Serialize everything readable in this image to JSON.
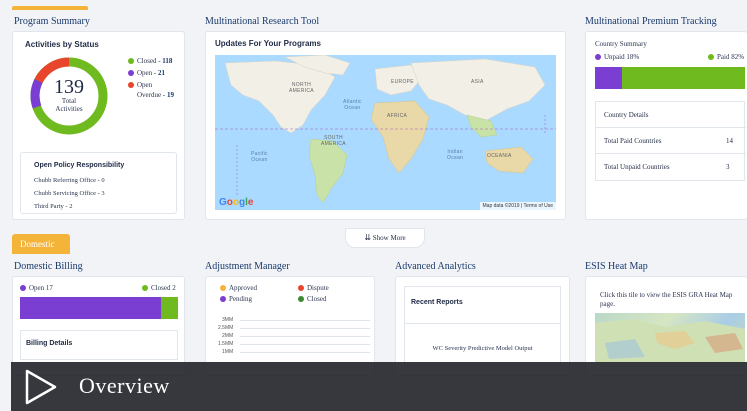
{
  "sections": {
    "program_summary": "Program Summary",
    "research_tool": "Multinational Research Tool",
    "premium_tracking": "Multinational Premium Tracking",
    "domestic_billing": "Domestic Billing",
    "adjustment_manager": "Adjustment Manager",
    "advanced_analytics": "Advanced Analytics",
    "heat_map": "ESIS Heat Map"
  },
  "program_summary": {
    "header": "Activities by Status",
    "total": "139",
    "total_label_1": "Total",
    "total_label_2": "Activities",
    "legend": [
      {
        "label": "Closed",
        "value": "118",
        "color": "#6fba1e"
      },
      {
        "label": "Open",
        "value": "21",
        "color": "#7b3ed2"
      },
      {
        "label_1": "Open",
        "label_2": "Overdue",
        "value": "19",
        "color": "#e8452c"
      }
    ],
    "policy": {
      "title": "Open Policy Responsibility",
      "lines": [
        "Chubb Referring Office - 0",
        "Chubb Servicing Office - 3",
        "Third Party - 2"
      ]
    }
  },
  "research_tool": {
    "header": "Updates For Your Programs",
    "map_labels": {
      "north_america": "NORTH\nAMERICA",
      "europe": "EUROPE",
      "asia": "ASIA",
      "africa": "AFRICA",
      "south_america": "SOUTH\nAMERICA",
      "oceania": "OCEANIA",
      "atlantic": "Atlantic\nOcean",
      "pacific": "Pacific\nOcean",
      "indian": "Indian\nOcean"
    },
    "map_footer": "Map data ©2019 | Terms of Use",
    "google": "Google"
  },
  "premium_tracking": {
    "country_summary": "Country Summary",
    "unpaid": "Unpaid 18%",
    "paid": "Paid 82%",
    "unpaid_fraction": 0.18,
    "details_title": "Country Details",
    "rows": [
      {
        "label": "Total Paid Countries",
        "value": "14"
      },
      {
        "label": "Total Unpaid Countries",
        "value": "3"
      }
    ]
  },
  "show_more": "Show More",
  "domestic_tab": "Domestic",
  "domestic_billing": {
    "open": "Open 17",
    "closed": "Closed 2",
    "open_fraction": 0.89,
    "details": "Billing Details"
  },
  "adjustment_manager": {
    "legend": [
      {
        "label": "Approved",
        "color": "#f4b43a"
      },
      {
        "label": "Dispute",
        "color": "#e8452c"
      },
      {
        "label": "Pending",
        "color": "#7b3ed2"
      },
      {
        "label": "Closed",
        "color": "#3b8a2e"
      }
    ],
    "y_ticks": [
      "3MM",
      "2.5MM",
      "2MM",
      "1.5MM",
      "1MM"
    ]
  },
  "advanced_analytics": {
    "title": "Recent Reports",
    "item": "WC Severity Predictive Model Output"
  },
  "heat_map": {
    "text": "Click this tile to view the ESIS GRA Heat Map page."
  },
  "overlay": {
    "title": "Overview"
  },
  "colors": {
    "accent": "#f4b43a",
    "closed_green": "#6fba1e",
    "open_purple": "#7b3ed2",
    "overdue_red": "#e8452c"
  }
}
